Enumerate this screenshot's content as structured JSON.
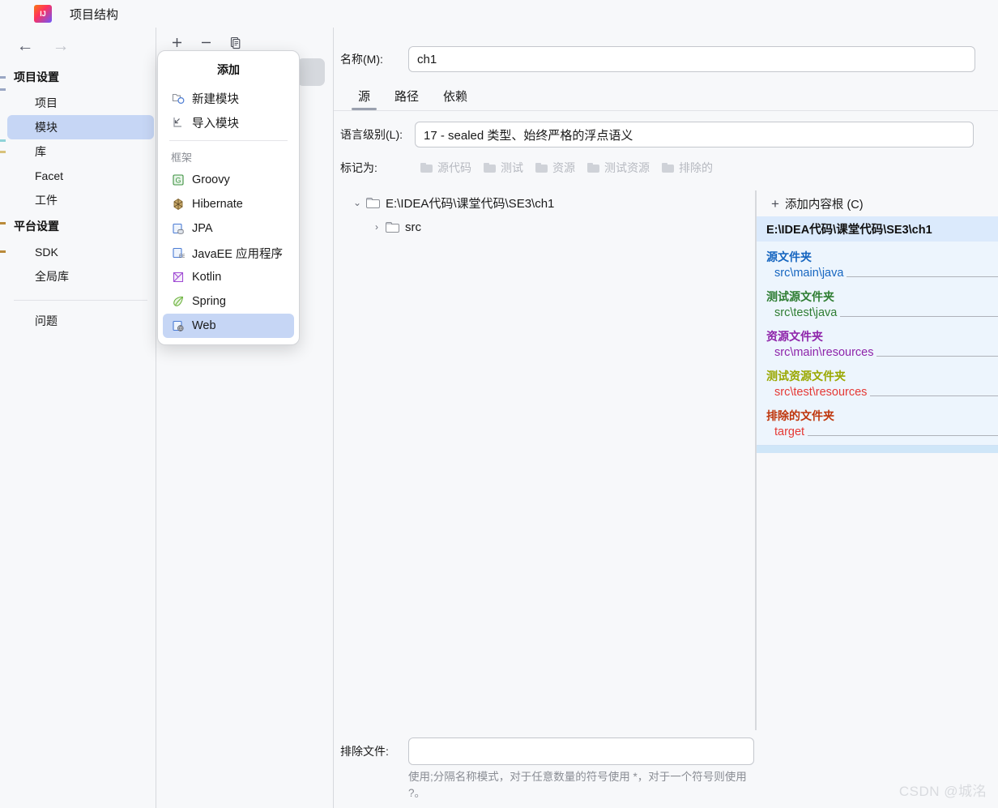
{
  "window": {
    "title": "项目结构",
    "logo_icon": "intellij-idea-logo"
  },
  "nav": {
    "back_icon": "arrow-left-icon",
    "forward_icon": "arrow-right-icon"
  },
  "sidebar": {
    "groups": [
      {
        "title": "项目设置",
        "items": [
          {
            "label": "项目",
            "selected": false
          },
          {
            "label": "模块",
            "selected": true
          },
          {
            "label": "库",
            "selected": false
          },
          {
            "label": "Facet",
            "selected": false
          },
          {
            "label": "工件",
            "selected": false
          }
        ]
      },
      {
        "title": "平台设置",
        "items": [
          {
            "label": "SDK",
            "selected": false
          },
          {
            "label": "全局库",
            "selected": false
          }
        ]
      }
    ],
    "problems": {
      "label": "问题"
    }
  },
  "modules_toolbar": {
    "add_icon": "plus-icon",
    "remove_icon": "minus-icon",
    "copy_icon": "copy-icon"
  },
  "popup": {
    "title": "添加",
    "items": [
      {
        "label": "新建模块",
        "icon": "new-module-icon",
        "selected": false
      },
      {
        "label": "导入模块",
        "icon": "import-module-icon",
        "selected": false
      }
    ],
    "group_label": "框架",
    "frameworks": [
      {
        "label": "Groovy",
        "icon": "groovy-icon",
        "glyph": "G",
        "color": "#3d9140",
        "selected": false
      },
      {
        "label": "Hibernate",
        "icon": "hibernate-icon",
        "glyph": "◆",
        "color": "#b39155",
        "selected": false
      },
      {
        "label": "JPA",
        "icon": "jpa-icon",
        "glyph": "▤",
        "color": "#4c7cd4",
        "selected": false
      },
      {
        "label": "JavaEE 应用程序",
        "icon": "javaee-icon",
        "glyph": "EE",
        "color": "#4c7cd4",
        "selected": false
      },
      {
        "label": "Kotlin",
        "icon": "kotlin-icon",
        "glyph": "K",
        "color": "#a04cd4",
        "selected": false
      },
      {
        "label": "Spring",
        "icon": "spring-icon",
        "glyph": "❧",
        "color": "#6db33f",
        "selected": false
      },
      {
        "label": "Web",
        "icon": "web-icon",
        "glyph": "⊕",
        "color": "#4c7cd4",
        "selected": true
      }
    ]
  },
  "detail": {
    "name_label": "名称(M):",
    "name_value": "ch1",
    "tabs": [
      {
        "label": "源",
        "active": true
      },
      {
        "label": "路径",
        "active": false
      },
      {
        "label": "依赖",
        "active": false
      }
    ],
    "language_level_label": "语言级别(L):",
    "language_level_value": "17 - sealed 类型、始终严格的浮点语义",
    "mark_as_label": "标记为:",
    "mark_as_options": [
      {
        "label": "源代码",
        "icon": "folder-sources-icon"
      },
      {
        "label": "测试",
        "icon": "folder-tests-icon"
      },
      {
        "label": "资源",
        "icon": "folder-resources-icon"
      },
      {
        "label": "测试资源",
        "icon": "folder-test-resources-icon"
      },
      {
        "label": "排除的",
        "icon": "folder-excluded-icon"
      }
    ],
    "tree": [
      {
        "label": "E:\\IDEA代码\\课堂代码\\SE3\\ch1",
        "expanded": true,
        "depth": 0,
        "chevron": "chevron-down-icon"
      },
      {
        "label": "src",
        "expanded": false,
        "depth": 1,
        "chevron": "chevron-right-icon"
      }
    ],
    "content_roots": {
      "add_label": "添加内容根 (C)",
      "add_icon": "plus-icon",
      "root_path": "E:\\IDEA代码\\课堂代码\\SE3\\ch1",
      "sections": [
        {
          "title": "源文件夹",
          "title_color": "#1565c0",
          "path": "src\\main\\java",
          "path_color": "#1565c0"
        },
        {
          "title": "测试源文件夹",
          "title_color": "#2e7d32",
          "path": "src\\test\\java",
          "path_color": "#2e7d32"
        },
        {
          "title": "资源文件夹",
          "title_color": "#8e24aa",
          "path": "src\\main\\resources",
          "path_color": "#8e24aa"
        },
        {
          "title": "测试资源文件夹",
          "title_color": "#9aa800",
          "path": "src\\test\\resources",
          "path_color": "#e53935"
        },
        {
          "title": "排除的文件夹",
          "title_color": "#bf360c",
          "path": "target",
          "path_color": "#e53935"
        }
      ]
    },
    "exclude": {
      "label": "排除文件:",
      "value": "",
      "hint": "使用;分隔名称模式，对于任意数量的符号使用 *，对于一个符号则使用 ?。"
    }
  },
  "watermark": {
    "text": "CSDN @城洺"
  }
}
